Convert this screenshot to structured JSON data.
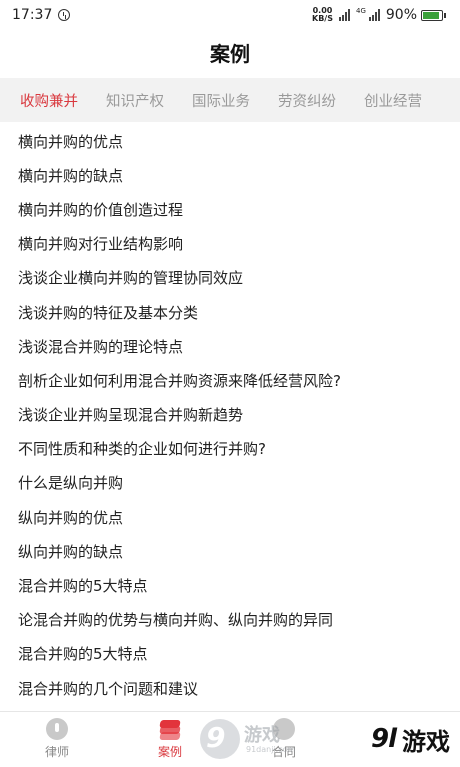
{
  "status": {
    "time": "17:37",
    "speed_value": "0.00",
    "speed_unit": "KB/S",
    "net_tag": "4G",
    "battery": "90%",
    "battery_level": 0.9
  },
  "header": {
    "title": "案例"
  },
  "tabs": [
    {
      "label": "收购兼并",
      "active": true
    },
    {
      "label": "知识产权",
      "active": false
    },
    {
      "label": "国际业务",
      "active": false
    },
    {
      "label": "劳资纠纷",
      "active": false
    },
    {
      "label": "创业经营",
      "active": false
    }
  ],
  "list": [
    "横向并购的优点",
    "横向并购的缺点",
    "横向并购的价值创造过程",
    "横向并购对行业结构影响",
    "浅谈企业横向并购的管理协同效应",
    "浅谈并购的特征及基本分类",
    "浅谈混合并购的理论特点",
    "剖析企业如何利用混合并购资源来降低经营风险?",
    "浅谈企业并购呈现混合并购新趋势",
    "不同性质和种类的企业如何进行并购?",
    "什么是纵向并购",
    "纵向并购的优点",
    "纵向并购的缺点",
    "混合并购的5大特点",
    "论混合并购的优势与横向并购、纵向并购的异同",
    "混合并购的5大特点",
    "混合并购的几个问题和建议"
  ],
  "bottom_nav": {
    "lawyer": "律师",
    "case": "案例",
    "contract": "合同"
  },
  "watermark": {
    "left_logo": "9",
    "left_text": "游戏",
    "left_url": "91danji.com",
    "right_logo": "9l",
    "right_text": "游戏"
  },
  "colors": {
    "accent": "#d9383e",
    "tab_bg": "#f2f2f2"
  }
}
